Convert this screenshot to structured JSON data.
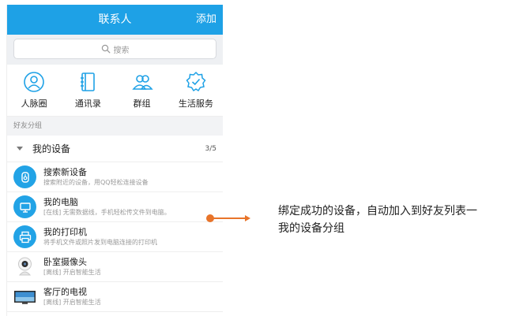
{
  "header": {
    "title": "联系人",
    "add_label": "添加"
  },
  "search": {
    "placeholder": "搜索"
  },
  "quick_actions": [
    {
      "label": "人脉圈",
      "icon": "people-circle-icon"
    },
    {
      "label": "通讯录",
      "icon": "address-book-icon"
    },
    {
      "label": "群组",
      "icon": "group-icon"
    },
    {
      "label": "生活服务",
      "icon": "life-service-icon"
    }
  ],
  "section": {
    "label": "好友分组"
  },
  "group": {
    "name": "我的设备",
    "count": "3/5",
    "items": [
      {
        "name": "搜索新设备",
        "subtitle": "搜索附近的设备，用QQ轻松连接设备",
        "icon": "search-device-icon"
      },
      {
        "name": "我的电脑",
        "subtitle": "[在线] 无需数据线，手机轻松传文件到电脑。",
        "icon": "computer-icon"
      },
      {
        "name": "我的打印机",
        "subtitle": "将手机文件或照片发到电脑连接的打印机",
        "icon": "printer-icon"
      },
      {
        "name": "卧室摄像头",
        "subtitle": "[离线] 开启智能生活",
        "icon": "camera-icon"
      },
      {
        "name": "客厅的电视",
        "subtitle": "[离线] 开启智能生活",
        "icon": "tv-icon"
      }
    ]
  },
  "annotation": {
    "line1": "绑定成功的设备，自动加入到好友列表一",
    "line2": "我的设备分组"
  },
  "colors": {
    "brand": "#1ea1e6",
    "connector": "#e8742a"
  }
}
